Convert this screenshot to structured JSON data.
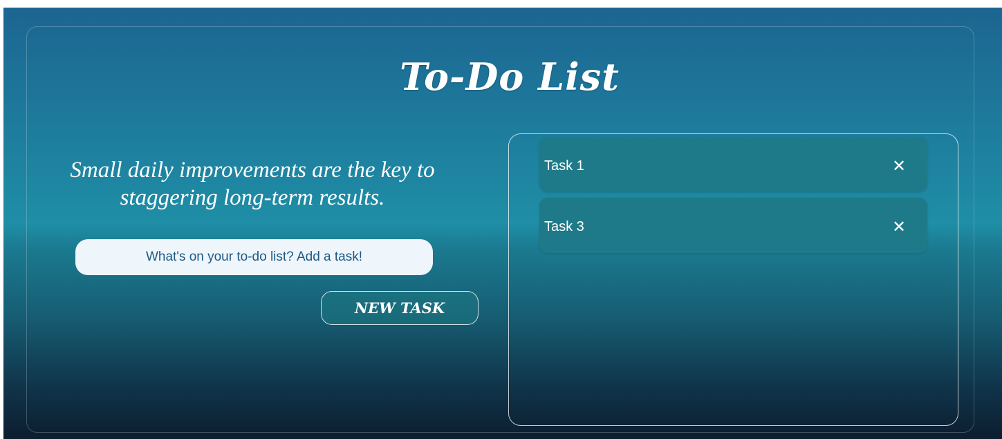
{
  "app": {
    "title": "To-Do List"
  },
  "quote": {
    "text": "Small daily improvements are the key to staggering long-term results."
  },
  "input": {
    "placeholder": "What's on your to-do list? Add a task!",
    "value": ""
  },
  "new_task_button": {
    "label": "NEW TASK"
  },
  "tasks": [
    {
      "label": "Task 1",
      "delete_icon": "close-icon",
      "delete_glyph": "✕"
    },
    {
      "label": "Task 3",
      "delete_icon": "close-icon",
      "delete_glyph": "✕"
    }
  ],
  "colors": {
    "background_top": "#1c6591",
    "background_mid": "#1f8ea6",
    "background_bottom": "#0c1d2f",
    "task_item": "#1e7a88",
    "input_background": "#eef5fb",
    "input_text": "#1d5a84",
    "text": "#ffffff"
  }
}
